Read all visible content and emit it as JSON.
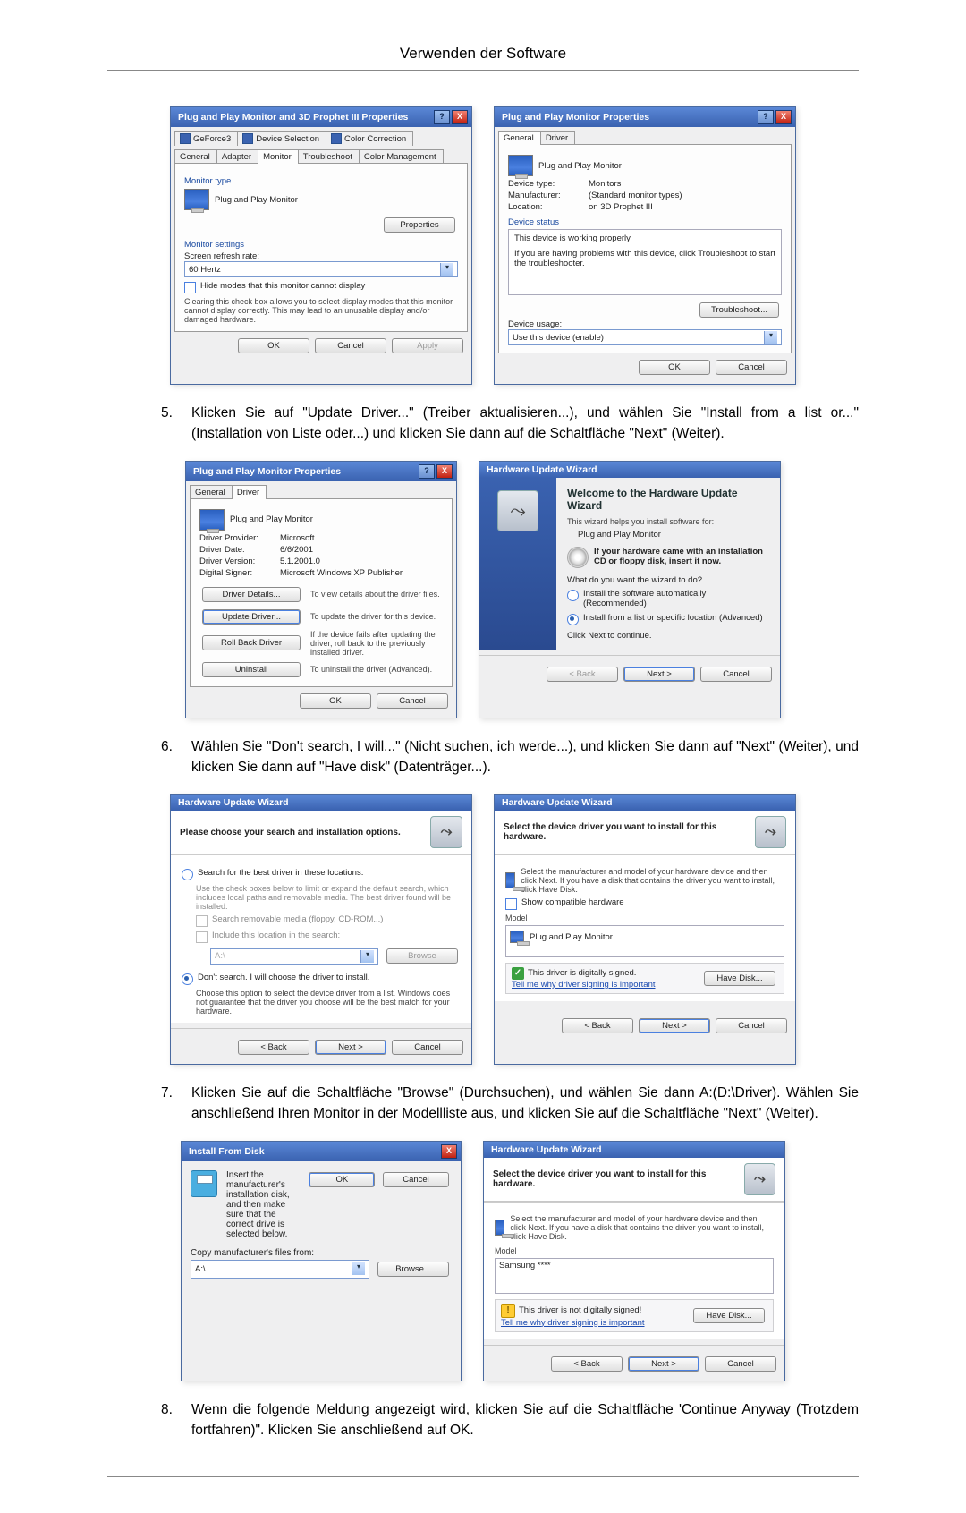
{
  "page_title": "Verwenden der Software",
  "steps": {
    "s5": {
      "num": "5.",
      "text": "Klicken Sie auf \"Update Driver...\" (Treiber aktualisieren...), und wählen Sie \"Install from a list or...\" (Installation von Liste oder...) und klicken Sie dann auf die Schaltfläche \"Next\" (Weiter)."
    },
    "s6": {
      "num": "6.",
      "text": "Wählen Sie \"Don't search, I will...\" (Nicht suchen, ich werde...), und klicken Sie dann auf \"Next\" (Weiter), und klicken Sie dann auf \"Have disk\" (Datenträger...)."
    },
    "s7": {
      "num": "7.",
      "text": "Klicken Sie auf die Schaltfläche \"Browse\" (Durchsuchen), und wählen Sie dann A:(D:\\Driver). Wählen Sie anschließend Ihren Monitor in der Modellliste aus, und klicken Sie auf die Schaltfläche \"Next\" (Weiter)."
    },
    "s8": {
      "num": "8.",
      "text": "Wenn die folgende Meldung angezeigt wird, klicken Sie auf die Schaltfläche 'Continue Anyway (Trotzdem fortfahren)\". Klicken Sie anschließend auf OK."
    }
  },
  "dlg": {
    "props3d_title": "Plug and Play Monitor and 3D Prophet III Properties",
    "props_title": "Plug and Play Monitor Properties",
    "huw_title": "Hardware Update Wizard",
    "install_title": "Install From Disk",
    "tabs_top": {
      "geforce": "GeForce3",
      "devsel": "Device Selection",
      "colorcorr": "Color Correction",
      "general": "General",
      "adapter": "Adapter",
      "monitor": "Monitor",
      "trouble": "Troubleshoot",
      "colorman": "Color Management",
      "driver": "Driver"
    },
    "monitor_type": "Monitor type",
    "pnp_monitor": "Plug and Play Monitor",
    "properties_btn": "Properties",
    "monitor_settings": "Monitor settings",
    "screen_refresh": "Screen refresh rate:",
    "sixty_hz": "60 Hertz",
    "hide_modes": "Hide modes that this monitor cannot display",
    "hide_modes_note": "Clearing this check box allows you to select display modes that this monitor cannot display correctly. This may lead to an unusable display and/or damaged hardware.",
    "ok": "OK",
    "cancel": "Cancel",
    "apply": "Apply",
    "dev_type_l": "Device type:",
    "dev_type_v": "Monitors",
    "mfg_l": "Manufacturer:",
    "mfg_v": "(Standard monitor types)",
    "loc_l": "Location:",
    "loc_v": "on 3D Prophet III",
    "device_status": "Device status",
    "status_working": "This device is working properly.",
    "status_trouble_hint": "If you are having problems with this device, click Troubleshoot to start the troubleshooter.",
    "troubleshoot_btn": "Troubleshoot...",
    "device_usage": "Device usage:",
    "use_enable": "Use this device (enable)",
    "drv_provider_l": "Driver Provider:",
    "drv_provider_v": "Microsoft",
    "drv_date_l": "Driver Date:",
    "drv_date_v": "6/6/2001",
    "drv_ver_l": "Driver Version:",
    "drv_ver_v": "5.1.2001.0",
    "drv_signer_l": "Digital Signer:",
    "drv_signer_v": "Microsoft Windows XP Publisher",
    "drv_details_btn": "Driver Details...",
    "drv_details_txt": "To view details about the driver files.",
    "drv_update_btn": "Update Driver...",
    "drv_update_txt": "To update the driver for this device.",
    "drv_rollback_btn": "Roll Back Driver",
    "drv_rollback_txt": "If the device fails after updating the driver, roll back to the previously installed driver.",
    "drv_uninstall_btn": "Uninstall",
    "drv_uninstall_txt": "To uninstall the driver (Advanced).",
    "wiz_welcome_title": "Welcome to the Hardware Update Wizard",
    "wiz_welcome_sub": "This wizard helps you install software for:",
    "wiz_cd_note": "If your hardware came with an installation CD or floppy disk, insert it now.",
    "wiz_what_do": "What do you want the wizard to do?",
    "wiz_opt_auto": "Install the software automatically (Recommended)",
    "wiz_opt_list": "Install from a list or specific location (Advanced)",
    "wiz_click_next": "Click Next to continue.",
    "back_btn": "< Back",
    "next_btn": "Next >",
    "choose_search": "Please choose your search and installation options.",
    "opt_search_loc": "Search for the best driver in these locations.",
    "opt_search_note": "Use the check boxes below to limit or expand the default search, which includes local paths and removable media. The best driver found will be installed.",
    "chk_removable": "Search removable media (floppy, CD-ROM...)",
    "chk_include_loc": "Include this location in the search:",
    "a_drive": "A:\\",
    "browse_btn": "Browse",
    "opt_dont_search": "Don't search. I will choose the driver to install.",
    "opt_dont_search_note": "Choose this option to select the device driver from a list. Windows does not guarantee that the driver you choose will be the best match for your hardware.",
    "select_device_hdr": "Select the device driver you want to install for this hardware.",
    "select_device_note": "Select the manufacturer and model of your hardware device and then click Next. If you have a disk that contains the driver you want to install, click Have Disk.",
    "show_compat": "Show compatible hardware",
    "model": "Model",
    "samsung_model": "Samsung ****",
    "signed": "This driver is digitally signed.",
    "not_signed": "This driver is not digitally signed!",
    "why_sign": "Tell me why driver signing is important",
    "have_disk": "Have Disk...",
    "install_disk_note": "Insert the manufacturer's installation disk, and then make sure that the correct drive is selected below.",
    "copy_from": "Copy manufacturer's files from:",
    "browse_ellipsis": "Browse..."
  }
}
